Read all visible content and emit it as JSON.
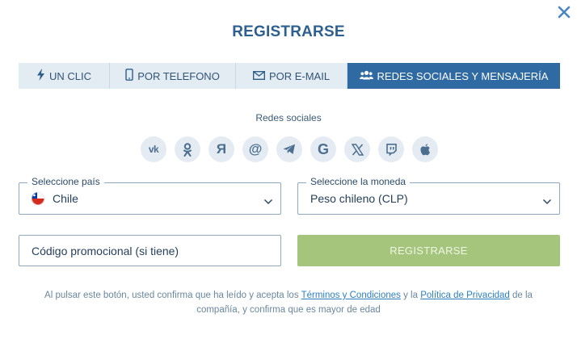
{
  "modal": {
    "title": "REGISTRARSE",
    "close_icon": "close-icon"
  },
  "tabs": [
    {
      "label": "UN CLIC",
      "icon": "lightning-icon",
      "active": false
    },
    {
      "label": "POR TELEFONO",
      "icon": "phone-icon",
      "active": false
    },
    {
      "label": "POR E-MAIL",
      "icon": "envelope-icon",
      "active": false
    },
    {
      "label": "REDES SOCIALES Y MENSAJERÍA",
      "icon": "users-icon",
      "active": true
    }
  ],
  "social": {
    "heading": "Redes sociales",
    "items": [
      {
        "name": "vk-icon",
        "glyph": "vk"
      },
      {
        "name": "odnoklassniki-icon",
        "glyph": ""
      },
      {
        "name": "yandex-icon",
        "glyph": "Я"
      },
      {
        "name": "mailru-icon",
        "glyph": "@"
      },
      {
        "name": "telegram-icon",
        "glyph": ""
      },
      {
        "name": "google-icon",
        "glyph": "G"
      },
      {
        "name": "x-icon",
        "glyph": "𝕏"
      },
      {
        "name": "twitch-icon",
        "glyph": ""
      },
      {
        "name": "apple-icon",
        "glyph": ""
      }
    ]
  },
  "country": {
    "label": "Seleccione país",
    "value": "Chile",
    "flag": "chile-flag-icon"
  },
  "currency": {
    "label": "Seleccione la moneda",
    "value": "Peso chileno (CLP)"
  },
  "promo": {
    "placeholder": "Código promocional (si tiene)"
  },
  "submit": {
    "label": "REGISTRARSE"
  },
  "legal": {
    "text_before": "Al pulsar este botón, usted confirma que ha leído y acepta los ",
    "terms_link": "Términos y Condiciones",
    "text_middle": " y la ",
    "privacy_link": "Política de Privacidad",
    "text_after": " de la compañía, y confirma que es mayor de edad"
  },
  "colors": {
    "primary": "#2f6aa3",
    "title": "#2d5f8f",
    "tab_bg": "#e3ebf3",
    "button_disabled": "#a5c57d",
    "link": "#2f7fbf"
  }
}
